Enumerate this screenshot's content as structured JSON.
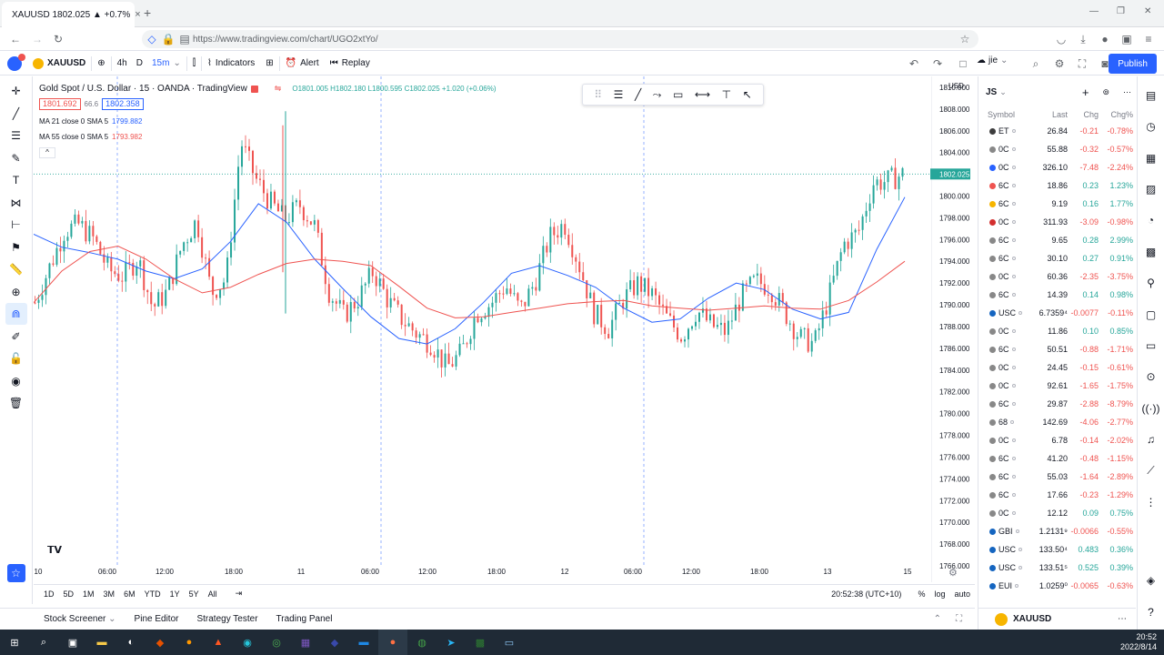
{
  "browser": {
    "tab_title": "XAUUSD 1802.025 ▲ +0.7%",
    "tab_close": "×",
    "new_tab": "+",
    "url": "https://www.tradingview.com/chart/UGO2xtYo/",
    "window_controls": [
      "—",
      "❐",
      "✕"
    ]
  },
  "toolbar": {
    "symbol": "XAUUSD",
    "interval_4h": "4h",
    "interval_d": "D",
    "interval_15m": "15m",
    "indicators": "Indicators",
    "alert": "Alert",
    "replay": "Replay",
    "user": "jie",
    "publish": "Publish"
  },
  "legend": {
    "title": "Gold Spot / U.S. Dollar · 15 · OANDA · TradingView",
    "ohlc": "O1801.005 H1802.180 L1800.595 C1802.025 +1.020 (+0.06%)",
    "bid": "1801.692",
    "spread": "66.6",
    "ask": "1802.358",
    "ma1_label": "MA 21 close 0 SMA 5",
    "ma1_value": "1799.882",
    "ma2_label": "MA 55 close 0 SMA 5",
    "ma2_value": "1793.982",
    "currency": "USD"
  },
  "chart_data": {
    "type": "candlestick",
    "symbol": "XAUUSD",
    "title": "Gold Spot / U.S. Dollar · 15 · OANDA · TradingView",
    "ylim": [
      1766,
      1811
    ],
    "yticks": [
      1810,
      1808,
      1806,
      1804,
      1802,
      1800,
      1798,
      1796,
      1794,
      1792,
      1790,
      1788,
      1786,
      1784,
      1782,
      1780,
      1778,
      1776,
      1774,
      1772,
      1770,
      1768,
      1766
    ],
    "ytick_labels": [
      "1810.000",
      "1808.000",
      "1806.000",
      "1804.000",
      "1802.000",
      "1800.000",
      "1798.000",
      "1796.000",
      "1794.000",
      "1792.000",
      "1790.000",
      "1788.000",
      "1786.000",
      "1784.000",
      "1782.000",
      "1780.000",
      "1778.000",
      "1776.000",
      "1774.000",
      "1772.000",
      "1770.000",
      "1768.000",
      "1766.000"
    ],
    "xtick_labels": [
      "10",
      "06:00",
      "12:00",
      "18:00",
      "11",
      "06:00",
      "12:00",
      "18:00",
      "12",
      "06:00",
      "12:00",
      "18:00",
      "13",
      "15"
    ],
    "last_price_label": "1802.025",
    "last_price": 1802.025,
    "series": [
      {
        "name": "MA 21 close 0 SMA 5",
        "color": "#2962ff",
        "values": [
          1796.5,
          1795.3,
          1794.8,
          1794.2,
          1793.1,
          1792.4,
          1793.3,
          1795.8,
          1799.3,
          1797.6,
          1794.2,
          1791.5,
          1788.9,
          1786.9,
          1786.4,
          1787.8,
          1790.2,
          1792.9,
          1793.6,
          1792.7,
          1791.6,
          1789.7,
          1788.4,
          1788.7,
          1790.6,
          1792.0,
          1791.4,
          1789.6,
          1788.7,
          1789.3,
          1795.1,
          1799.9
        ]
      },
      {
        "name": "MA 55 close 0 SMA 5",
        "color": "#ef5350",
        "values": [
          1790.2,
          1793.1,
          1794.9,
          1795.4,
          1794.2,
          1792.4,
          1791.1,
          1791.6,
          1792.8,
          1793.8,
          1794.2,
          1794.0,
          1793.6,
          1791.7,
          1789.7,
          1788.8,
          1788.9,
          1789.3,
          1789.7,
          1790.1,
          1790.3,
          1790.4,
          1789.9,
          1789.7,
          1789.5,
          1789.7,
          1789.9,
          1789.7,
          1789.6,
          1790.4,
          1792.1,
          1794.0
        ]
      }
    ],
    "candle_closes": [
      1790.2,
      1793.5,
      1796.8,
      1797.4,
      1796.0,
      1793.2,
      1792.6,
      1794.3,
      1789.7,
      1791.2,
      1795.5,
      1797.8,
      1791.1,
      1792.4,
      1805.0,
      1801.6,
      1799.4,
      1797.8,
      1799.2,
      1797.3,
      1791.2,
      1789.0,
      1790.6,
      1793.1,
      1790.4,
      1788.6,
      1787.3,
      1786.4,
      1784.2,
      1785.6,
      1789.2,
      1790.1,
      1791.8,
      1789.5,
      1792.1,
      1796.2,
      1797.5,
      1793.7,
      1789.3,
      1787.8,
      1790.5,
      1792.0,
      1790.9,
      1788.7,
      1787.1,
      1789.5,
      1788.1,
      1787.5,
      1790.7,
      1792.2,
      1791.6,
      1789.3,
      1787.0,
      1786.4,
      1790.8,
      1795.6,
      1796.7,
      1801.2,
      1801.4,
      1802.0
    ]
  },
  "timeframes": [
    "1D",
    "5D",
    "1M",
    "3M",
    "6M",
    "YTD",
    "1Y",
    "5Y",
    "All"
  ],
  "timeclock": "20:52:38 (UTC+10)",
  "scale_options": [
    "%",
    "log",
    "auto"
  ],
  "bottom_tabs": [
    "Stock Screener",
    "Pine Editor",
    "Strategy Tester",
    "Trading Panel"
  ],
  "watchlist": {
    "name": "JS",
    "headers": [
      "Symbol",
      "Last",
      "Chg",
      "Chg%"
    ],
    "rows": [
      {
        "sym": "ET",
        "icon": "#3c3c3d",
        "last": "26.84",
        "chg": "-0.21",
        "pct": "-0.78%",
        "dir": "neg"
      },
      {
        "sym": "0C",
        "icon": "#888",
        "last": "55.88",
        "chg": "-0.32",
        "pct": "-0.57%",
        "dir": "neg"
      },
      {
        "sym": "0C",
        "icon": "#2962ff",
        "last": "326.10",
        "chg": "-7.48",
        "pct": "-2.24%",
        "dir": "neg"
      },
      {
        "sym": "6C",
        "icon": "#ef5350",
        "last": "18.86",
        "chg": "0.23",
        "pct": "1.23%",
        "dir": "pos"
      },
      {
        "sym": "6C",
        "icon": "#f7b500",
        "last": "9.19",
        "chg": "0.16",
        "pct": "1.77%",
        "dir": "pos"
      },
      {
        "sym": "0C",
        "icon": "#d32f2f",
        "last": "311.93",
        "chg": "-3.09",
        "pct": "-0.98%",
        "dir": "neg"
      },
      {
        "sym": "6C",
        "icon": "#888",
        "last": "9.65",
        "chg": "0.28",
        "pct": "2.99%",
        "dir": "pos"
      },
      {
        "sym": "6C",
        "icon": "#888",
        "last": "30.10",
        "chg": "0.27",
        "pct": "0.91%",
        "dir": "pos"
      },
      {
        "sym": "0C",
        "icon": "#888",
        "last": "60.36",
        "chg": "-2.35",
        "pct": "-3.75%",
        "dir": "neg"
      },
      {
        "sym": "6C",
        "icon": "#888",
        "last": "14.39",
        "chg": "0.14",
        "pct": "0.98%",
        "dir": "pos"
      },
      {
        "sym": "USC",
        "icon": "#1565c0",
        "last": "6.7359⁴",
        "chg": "-0.0077",
        "pct": "-0.11%",
        "dir": "neg"
      },
      {
        "sym": "0C",
        "icon": "#888",
        "last": "11.86",
        "chg": "0.10",
        "pct": "0.85%",
        "dir": "pos"
      },
      {
        "sym": "6C",
        "icon": "#888",
        "last": "50.51",
        "chg": "-0.88",
        "pct": "-1.71%",
        "dir": "neg"
      },
      {
        "sym": "0C",
        "icon": "#888",
        "last": "24.45",
        "chg": "-0.15",
        "pct": "-0.61%",
        "dir": "neg"
      },
      {
        "sym": "0C",
        "icon": "#888",
        "last": "92.61",
        "chg": "-1.65",
        "pct": "-1.75%",
        "dir": "neg"
      },
      {
        "sym": "6C",
        "icon": "#888",
        "last": "29.87",
        "chg": "-2.88",
        "pct": "-8.79%",
        "dir": "neg"
      },
      {
        "sym": "68",
        "icon": "#888",
        "last": "142.69",
        "chg": "-4.06",
        "pct": "-2.77%",
        "dir": "neg"
      },
      {
        "sym": "0C",
        "icon": "#888",
        "last": "6.78",
        "chg": "-0.14",
        "pct": "-2.02%",
        "dir": "neg"
      },
      {
        "sym": "6C",
        "icon": "#888",
        "last": "41.20",
        "chg": "-0.48",
        "pct": "-1.15%",
        "dir": "neg"
      },
      {
        "sym": "6C",
        "icon": "#888",
        "last": "55.03",
        "chg": "-1.64",
        "pct": "-2.89%",
        "dir": "neg"
      },
      {
        "sym": "6C",
        "icon": "#888",
        "last": "17.66",
        "chg": "-0.23",
        "pct": "-1.29%",
        "dir": "neg"
      },
      {
        "sym": "0C",
        "icon": "#888",
        "last": "12.12",
        "chg": "0.09",
        "pct": "0.75%",
        "dir": "pos"
      },
      {
        "sym": "GBI",
        "icon": "#1565c0",
        "last": "1.2131⁹",
        "chg": "-0.0066",
        "pct": "-0.55%",
        "dir": "neg"
      },
      {
        "sym": "USC",
        "icon": "#1565c0",
        "last": "133.50⁴",
        "chg": "0.483",
        "pct": "0.36%",
        "dir": "pos"
      },
      {
        "sym": "USC",
        "icon": "#1565c0",
        "last": "133.51⁵",
        "chg": "0.525",
        "pct": "0.39%",
        "dir": "pos"
      },
      {
        "sym": "EUI",
        "icon": "#1565c0",
        "last": "1.0259⁰",
        "chg": "-0.0065",
        "pct": "-0.63%",
        "dir": "neg"
      }
    ]
  },
  "footer_symbol": "XAUUSD",
  "taskbar": {
    "time": "20:52",
    "date": "2022/8/14"
  },
  "colors": {
    "up": "#26a69a",
    "down": "#ef5350",
    "accent": "#2962ff"
  }
}
